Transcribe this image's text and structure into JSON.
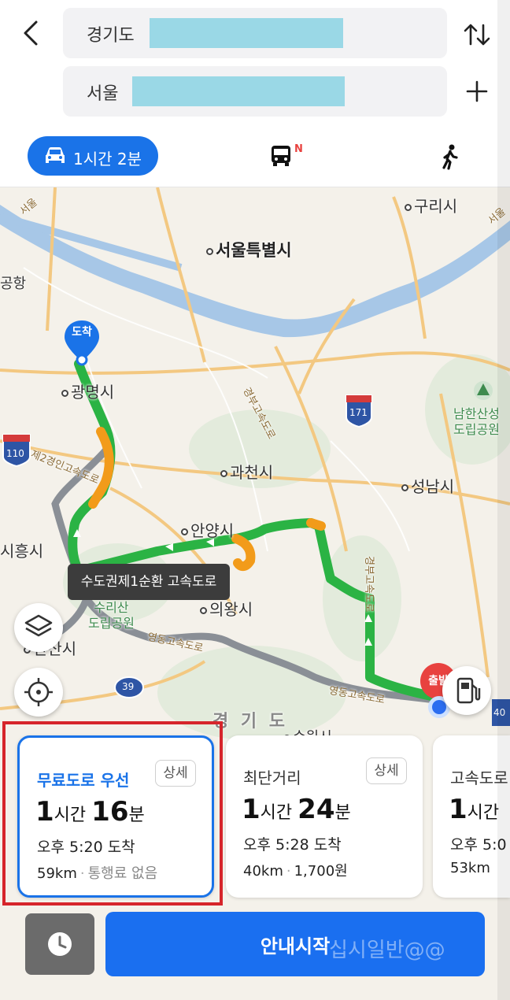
{
  "header": {
    "origin_label": "경기도",
    "destination_label": "서울"
  },
  "modes": {
    "car_time": "1시간 2분",
    "bus_badge": "N"
  },
  "map": {
    "labels": {
      "guri": "구리시",
      "seoul": "서울특별시",
      "airport": "공항",
      "gwangmyeong": "광명시",
      "gwacheon": "과천시",
      "seongnam": "성남시",
      "anyang": "안양시",
      "siheung": "시흥시",
      "uiwang": "의왕시",
      "ansan": "안산시",
      "namhansanseong": "남한산성\n도립공원",
      "surisan": "수리산\n도립공원",
      "gyeonggido": "경 기 도",
      "suwon": "수원시"
    },
    "road_labels": {
      "gyeongbu": "경부고속도로",
      "second_gyeongin": "제2경인고속도로",
      "yeongdong_1": "영동고속도로",
      "yeongdong_2": "영동고속도로",
      "gyeongbu_2": "경부고속도로",
      "seoul_top": "서울",
      "top_left_road": "서울"
    },
    "shields": {
      "s171": "171",
      "s110": "110",
      "s39": "39",
      "s40": "40"
    },
    "dest_pin": "도착",
    "start_pin": "출발",
    "tooltip": "수도권제1순환 고속도로"
  },
  "routes": [
    {
      "name": "무료도로 우선",
      "detail": "상세",
      "hours": "1",
      "hour_unit": "시간",
      "minutes": "16",
      "minute_unit": "분",
      "arrive": "오후 5:20 도착",
      "distance": "59km",
      "toll": "통행료 없음"
    },
    {
      "name": "최단거리",
      "detail": "상세",
      "hours": "1",
      "hour_unit": "시간",
      "minutes": "24",
      "minute_unit": "분",
      "arrive": "오후 5:28 도착",
      "distance": "40km",
      "toll": "1,700원"
    },
    {
      "name": "고속도로",
      "detail": "",
      "hours": "1",
      "hour_unit": "시간",
      "minutes": "",
      "minute_unit": "",
      "arrive": "오후 5:0",
      "distance": "53km",
      "toll": ""
    }
  ],
  "bottom": {
    "start_button": "안내시작",
    "watermark": "십시일반@@"
  },
  "colors": {
    "accent": "#1a73e8",
    "route_green": "#2bb344",
    "route_orange": "#f29b1a",
    "alt_route_gray": "#8a8f96",
    "highlight_red": "#d6252b"
  }
}
